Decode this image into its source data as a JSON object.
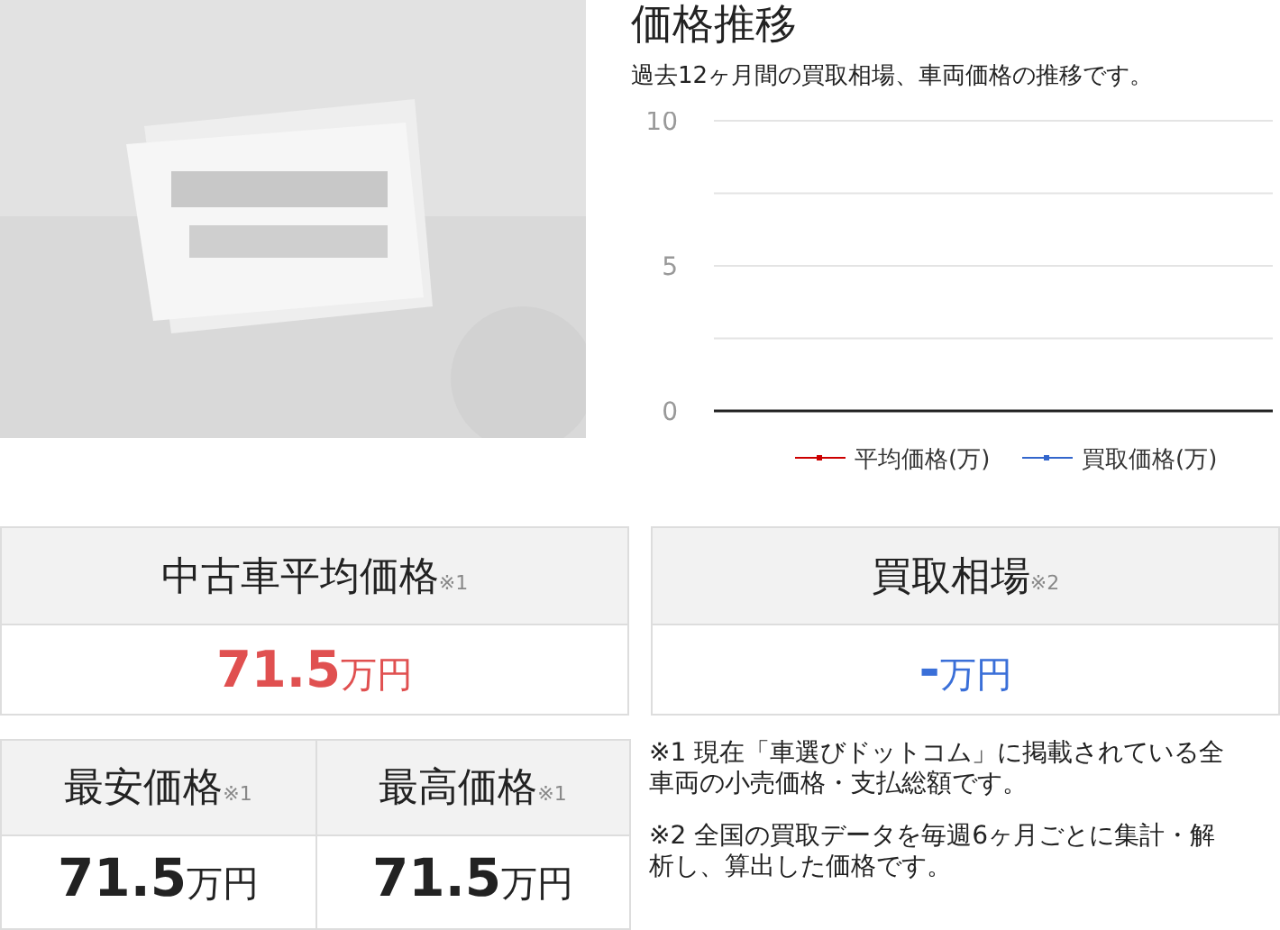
{
  "image": {
    "kind": "picture"
  },
  "price_trend": {
    "title": "価格推移",
    "description": "過去12ヶ月間の買取相場、車両価格の推移です。",
    "chart_data": {
      "type": "line",
      "ylim": [
        0,
        10
      ],
      "yticks": [
        0,
        5,
        10
      ],
      "series": [
        {
          "name": "平均価格(万)",
          "color": "#cc0000"
        },
        {
          "name": "買取価格(万)",
          "color": "#3366cc"
        }
      ]
    }
  },
  "summary_cards": [
    {
      "label": "中古車平均価格",
      "note_mark": "※1",
      "value": "71.5",
      "unit": "万円",
      "color": "#e05050"
    },
    {
      "label": "買取相場",
      "note_mark": "※2",
      "value": "-",
      "unit": "万円",
      "color": "#3a6fd8"
    }
  ],
  "price_range": [
    {
      "label": "最安価格",
      "note_mark": "※1",
      "value": "71.5",
      "unit": "万円"
    },
    {
      "label": "最高価格",
      "note_mark": "※1",
      "value": "71.5",
      "unit": "万円"
    }
  ],
  "notes": [
    "※1 現在「車選びドットコム」に掲載されている全車両の小売価格・支払総額です。",
    "※2 全国の買取データを毎週6ヶ月ごとに集計・解析し、算出した価格です。"
  ]
}
